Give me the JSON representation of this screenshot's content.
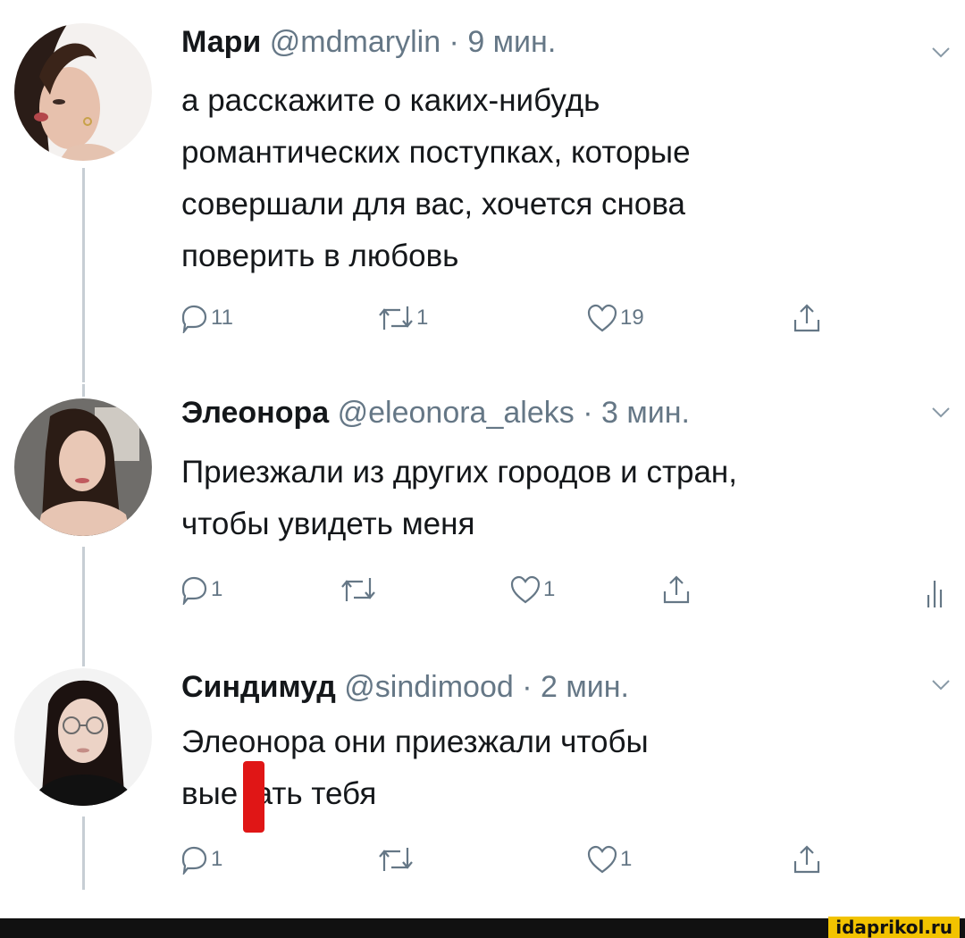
{
  "tweets": [
    {
      "name": "Мари",
      "handle": "@mdmarylin",
      "sep": " · ",
      "time": "9 мин.",
      "lines": [
        "а расскажите о каких-нибудь",
        "романтических поступках, которые",
        "совершали для вас, хочется снова",
        "поверить в любовь"
      ],
      "reply_count": "11",
      "retweet_count": "1",
      "like_count": "19"
    },
    {
      "name": "Элеонора",
      "handle": "@eleonora_aleks",
      "sep": " · ",
      "time": "3 мин.",
      "lines": [
        "Приезжали из других городов и стран,",
        "чтобы увидеть меня"
      ],
      "reply_count": "1",
      "retweet_count": "",
      "like_count": "1"
    },
    {
      "name": "Синдимуд",
      "handle": "@sindimood",
      "sep": " · ",
      "time": "2 мин.",
      "lines": [
        "Элеонора они приезжали чтобы",
        "вые  ать тебя"
      ],
      "reply_count": "1",
      "retweet_count": "",
      "like_count": "1"
    }
  ],
  "watermark": "idaprikol.ru",
  "colors": {
    "text": "#14171a",
    "secondary": "#657786",
    "thread_line": "#c7ced4",
    "redaction": "#e01616",
    "watermark_bg": "#f2c300"
  },
  "icons": [
    "reply-icon",
    "retweet-icon",
    "like-icon",
    "share-icon",
    "stats-icon",
    "chevron-down-icon"
  ]
}
